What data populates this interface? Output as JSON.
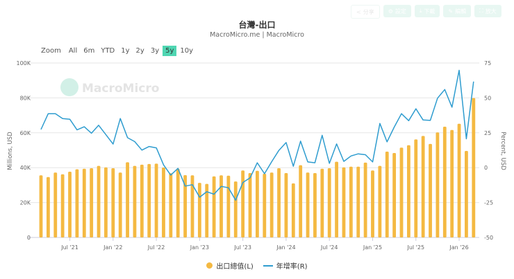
{
  "toolbar": {
    "buttons": [
      {
        "icon": "share-icon",
        "label": "分享"
      },
      {
        "icon": "gear-icon",
        "label": "設定"
      },
      {
        "icon": "download-icon",
        "label": "下載"
      },
      {
        "icon": "pencil-icon",
        "label": "編輯"
      },
      {
        "icon": "expand-icon",
        "label": "放大"
      }
    ]
  },
  "range_selector": {
    "label": "Zoom",
    "options": [
      "All",
      "6m",
      "YTD",
      "1y",
      "2y",
      "3y",
      "5y",
      "10y"
    ],
    "active": "5y"
  },
  "watermark": "MacroMicro",
  "chart_data": {
    "type": "bar+line",
    "title": "台灣-出口",
    "subtitle": "MacroMicro.me | MacroMicro",
    "ylabel_left": "Millions, USD",
    "ylabel_right": "Percent, USD",
    "ylim_left": [
      0,
      100000
    ],
    "ylim_right": [
      -50,
      75
    ],
    "yticks_left": [
      "0",
      "20K",
      "40K",
      "60K",
      "80K",
      "100K"
    ],
    "yticks_right": [
      "-50",
      "-25",
      "0",
      "25",
      "50",
      "75"
    ],
    "xticks": [
      {
        "label": "Jul '21",
        "index": 4
      },
      {
        "label": "Jan '22",
        "index": 10
      },
      {
        "label": "Jul '22",
        "index": 16
      },
      {
        "label": "Jan '23",
        "index": 22
      },
      {
        "label": "Jul '23",
        "index": 28
      },
      {
        "label": "Jan '24",
        "index": 34
      },
      {
        "label": "Jul '24",
        "index": 40
      },
      {
        "label": "Jan '25",
        "index": 46
      },
      {
        "label": "Jul '25",
        "index": 52
      },
      {
        "label": "Jan '26",
        "index": 58
      }
    ],
    "grid": true,
    "legend_position": "bottom-center",
    "categories": [
      "2021-03",
      "2021-04",
      "2021-05",
      "2021-06",
      "2021-07",
      "2021-08",
      "2021-09",
      "2021-10",
      "2021-11",
      "2021-12",
      "2022-01",
      "2022-02",
      "2022-03",
      "2022-04",
      "2022-05",
      "2022-06",
      "2022-07",
      "2022-08",
      "2022-09",
      "2022-10",
      "2022-11",
      "2022-12",
      "2023-01",
      "2023-02",
      "2023-03",
      "2023-04",
      "2023-05",
      "2023-06",
      "2023-07",
      "2023-08",
      "2023-09",
      "2023-10",
      "2023-11",
      "2023-12",
      "2024-01",
      "2024-02",
      "2024-03",
      "2024-04",
      "2024-05",
      "2024-06",
      "2024-07",
      "2024-08",
      "2024-09",
      "2024-10",
      "2024-11",
      "2024-12",
      "2025-01",
      "2025-02",
      "2025-03",
      "2025-04",
      "2025-05",
      "2025-06",
      "2025-07",
      "2025-08",
      "2025-09",
      "2025-10",
      "2025-11",
      "2025-12",
      "2026-01",
      "2026-02",
      "2026-03"
    ],
    "series": [
      {
        "name": "出口總值(L)",
        "type": "bar",
        "axis": "left",
        "color": "#f4b942",
        "values": [
          35600,
          34600,
          37200,
          36200,
          37700,
          39100,
          39400,
          39700,
          41000,
          40200,
          39700,
          37200,
          43100,
          41000,
          41700,
          42100,
          42300,
          40100,
          36800,
          39400,
          35700,
          35600,
          31300,
          30700,
          35000,
          35600,
          35400,
          32100,
          38400,
          36900,
          38200,
          36500,
          37200,
          39700,
          36900,
          31000,
          41400,
          37200,
          36900,
          39400,
          39700,
          43400,
          40200,
          40600,
          40600,
          42900,
          38400,
          41000,
          49200,
          48400,
          51500,
          52900,
          56200,
          58200,
          53600,
          60200,
          63500,
          61600,
          65200,
          49600,
          79900
        ]
      },
      {
        "name": "年增率(R)",
        "type": "line",
        "axis": "right",
        "color": "#2e9ccf",
        "values": [
          27.4,
          38.7,
          38.7,
          35.2,
          34.7,
          27.1,
          29.3,
          24.7,
          30.4,
          23.7,
          16.9,
          35.2,
          21.5,
          18.7,
          12.6,
          15.2,
          14.2,
          2.0,
          -5.3,
          -0.5,
          -13.2,
          -12.2,
          -21.2,
          -17.2,
          -19.0,
          -13.4,
          -14.4,
          -23.3,
          -10.6,
          -7.3,
          3.5,
          -4.3,
          4.3,
          12.4,
          18.0,
          1.0,
          19.0,
          4.1,
          3.5,
          23.2,
          3.1,
          17.0,
          4.5,
          8.4,
          9.9,
          9.3,
          4.1,
          31.7,
          18.5,
          29.1,
          38.7,
          33.7,
          42.2,
          34.2,
          33.9,
          49.8,
          56.0,
          43.3,
          69.8,
          20.7,
          61.7
        ]
      }
    ]
  }
}
